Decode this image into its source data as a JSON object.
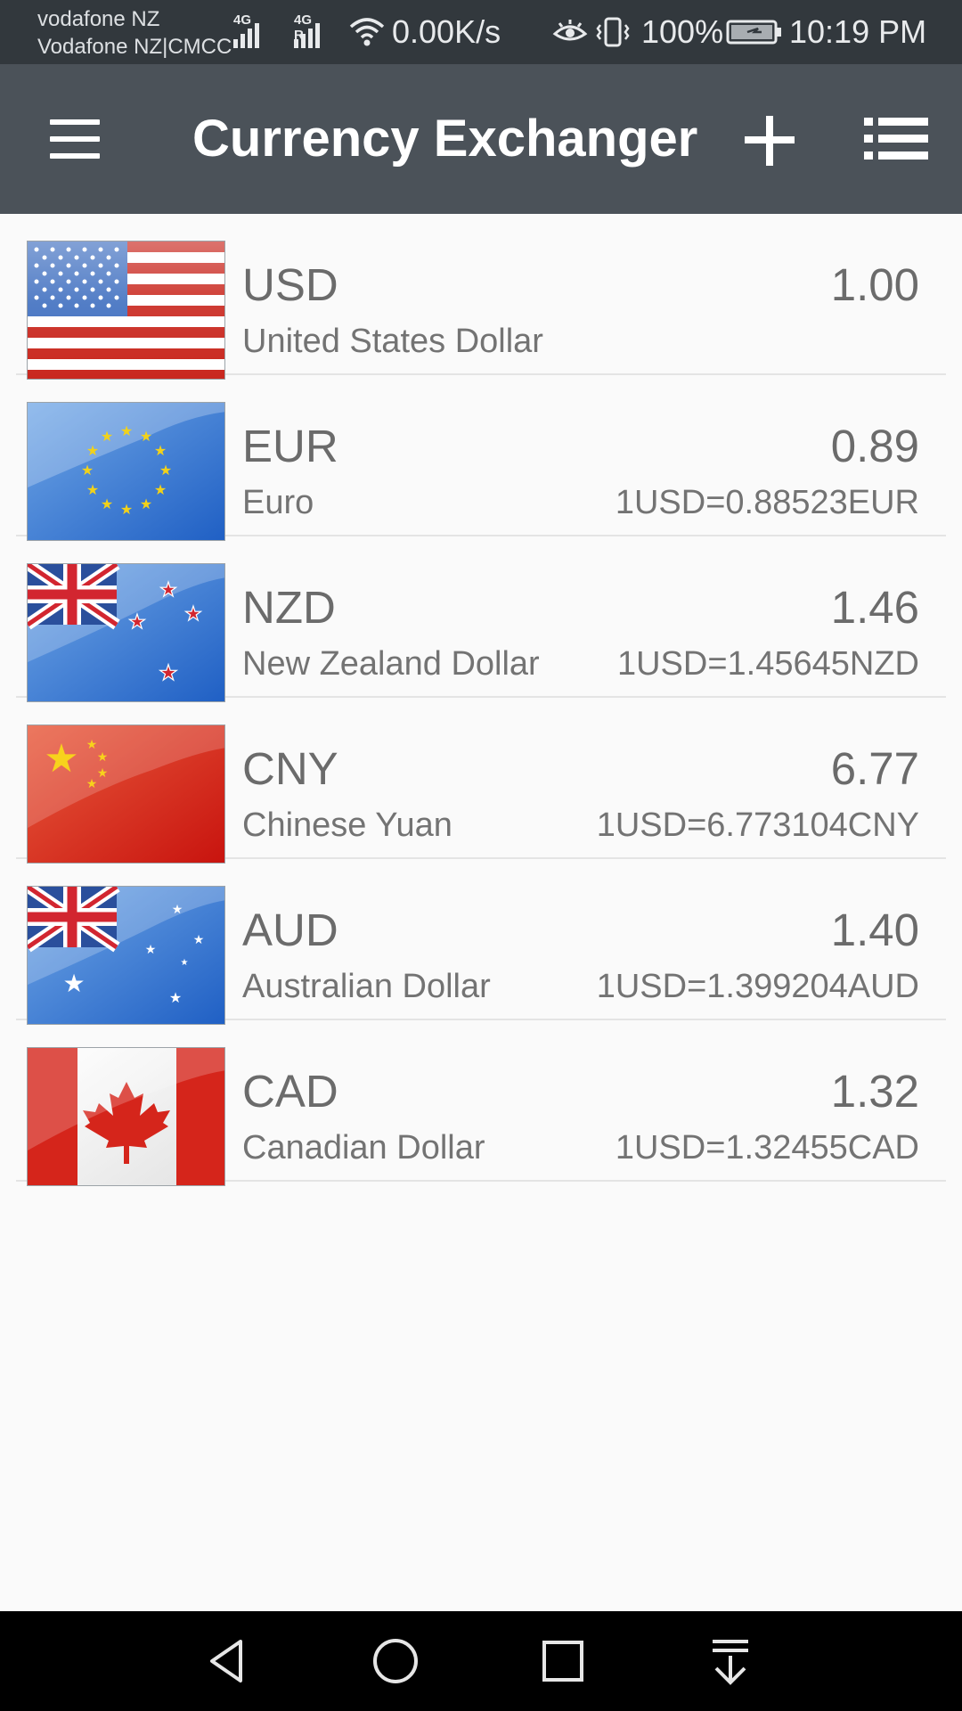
{
  "status_bar": {
    "carrier_line1": "vodafone NZ",
    "carrier_line2": "Vodafone NZ|CMCC",
    "network_1": "4G",
    "network_2": "4G R",
    "speed": "0.00K/s",
    "battery": "100%",
    "time": "10:19 PM"
  },
  "app_bar": {
    "title": "Currency Exchanger",
    "menu_icon": "hamburger-menu-icon",
    "add_icon": "plus-icon",
    "list_icon": "list-icon"
  },
  "currencies": [
    {
      "code": "USD",
      "name": "United States Dollar",
      "value": "1.00",
      "rate": "",
      "flag": "us-flag-icon"
    },
    {
      "code": "EUR",
      "name": "Euro",
      "value": "0.89",
      "rate": "1USD=0.88523EUR",
      "flag": "eu-flag-icon"
    },
    {
      "code": "NZD",
      "name": "New Zealand Dollar",
      "value": "1.46",
      "rate": "1USD=1.45645NZD",
      "flag": "nz-flag-icon"
    },
    {
      "code": "CNY",
      "name": "Chinese Yuan",
      "value": "6.77",
      "rate": "1USD=6.773104CNY",
      "flag": "cn-flag-icon"
    },
    {
      "code": "AUD",
      "name": "Australian Dollar",
      "value": "1.40",
      "rate": "1USD=1.399204AUD",
      "flag": "au-flag-icon"
    },
    {
      "code": "CAD",
      "name": "Canadian Dollar",
      "value": "1.32",
      "rate": "1USD=1.32455CAD",
      "flag": "ca-flag-icon"
    }
  ],
  "nav_bar": {
    "back_icon": "back-triangle-icon",
    "home_icon": "home-circle-icon",
    "recents_icon": "recents-square-icon",
    "notifications_icon": "pull-down-notifications-icon"
  },
  "colors": {
    "status_bar": "#32383d",
    "app_bar": "#4b5259",
    "background": "#fafafa",
    "text": "#6b6b6b"
  }
}
